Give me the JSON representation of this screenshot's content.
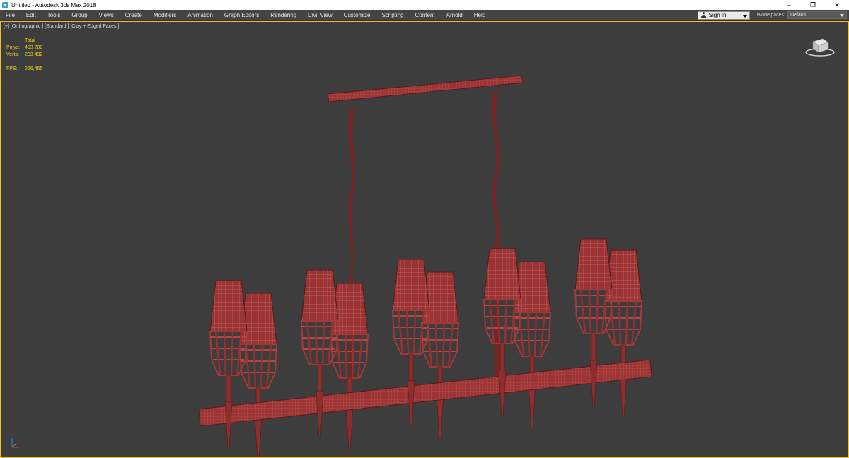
{
  "window": {
    "title": "Untitled - Autodesk 3ds Max 2018",
    "controls": [
      "–",
      "❐",
      "✕"
    ]
  },
  "menu": {
    "items": [
      "File",
      "Edit",
      "Tools",
      "Group",
      "Views",
      "Create",
      "Modifiers",
      "Animation",
      "Graph Editors",
      "Rendering",
      "Civil View",
      "Customize",
      "Scripting",
      "Content",
      "Arnold",
      "Help"
    ],
    "sign_in": "Sign In",
    "workspaces_label": "Workspaces:",
    "workspace_value": "Default"
  },
  "viewport": {
    "label": "[+] [Orthographic ] [Standard ] [Clay + Edged Faces ]",
    "stats": {
      "header": "Total",
      "polys_label": "Polys:",
      "polys_value": "403 200",
      "verts_label": "Verts:",
      "verts_value": "203 432",
      "fps_label": "FPS:",
      "fps_value": "226,465"
    }
  },
  "colors": {
    "stats_text": "#f4d21c",
    "viewport_bg": "#3d3d3d",
    "model_fill": "#9b3434",
    "model_wire": "#d86c6c",
    "active_border": "#f0c020"
  },
  "icons": {
    "app": "3ds-max-icon",
    "viewcube": "viewcube-icon",
    "axis": "axis-tripod-icon",
    "user": "user-icon"
  }
}
